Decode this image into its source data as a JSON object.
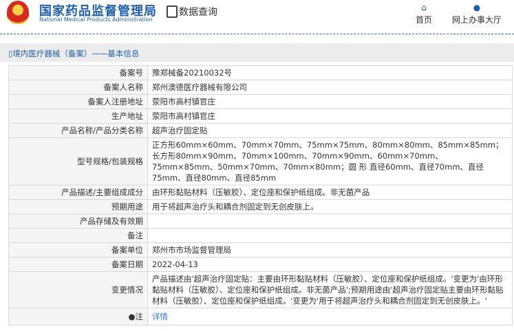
{
  "header": {
    "org_cn": "国家药品监督管理局",
    "org_en": "National Medical Products Administration",
    "query_label": "数据查询",
    "nav": [
      {
        "label": "首页",
        "icon": "home-icon"
      },
      {
        "label": "网上办事大厅",
        "icon": "user-icon"
      }
    ]
  },
  "breadcrumb": "境内医疗器械（备案）——基本信息",
  "rows": [
    {
      "label": "备案号",
      "value": "豫郑械备20210032号"
    },
    {
      "label": "备案人名称",
      "value": "郑州澳德医疗器械有限公司"
    },
    {
      "label": "备案人注册地址",
      "value": "荥阳市高村镇官庄"
    },
    {
      "label": "生产地址",
      "value": "荥阳市高村镇官庄"
    },
    {
      "label": "产品名称/产品分类名称",
      "value": "超声治疗固定贴"
    },
    {
      "label": "型号规格/包装规格",
      "value": "正方形60mm×60mm、70mm×70mm、75mm×75mm、80mm×80mm、85mm×85mm；长方形80mm×90mm、70mm×100mm、70mm×90mm、60mm×70mm、75mm×85mm、50mm×70mm、70mm×80mm；圆 形 直径60mm、直径70mm、直径75mm、直径80mm、直径85mm"
    },
    {
      "label": "产品描述/主要组成成分",
      "value": "由环形黏贴材料（压敏胶）、定位座和保护纸组成。非无菌产品"
    },
    {
      "label": "预期用途",
      "value": "用于将超声治疗头和耦合剂固定到无创皮肤上。"
    },
    {
      "label": "产品存储及有效期",
      "value": ""
    },
    {
      "label": "备注",
      "value": ""
    },
    {
      "label": "备案单位",
      "value": "郑州市市场监督管理局"
    },
    {
      "label": "备案日期",
      "value": "2022-04-13"
    },
    {
      "label": "变更情况",
      "value": "产品描述由'超声治疗固定贴：主要由环形黏贴材料（压敏胶）、定位座和保护纸组成。'变更为'由环形黏贴材料（压敏胶）、定位座和保护纸组成。非无菌产品';预期用途由'超声治疗固定贴主要由环形黏贴材料（压敏胶）、定位座和保护纸组成。'变更为'用于将超声治疗头和耦合剂固定到无创皮肤上。'"
    }
  ],
  "note": {
    "label": "注",
    "link": "详情"
  }
}
